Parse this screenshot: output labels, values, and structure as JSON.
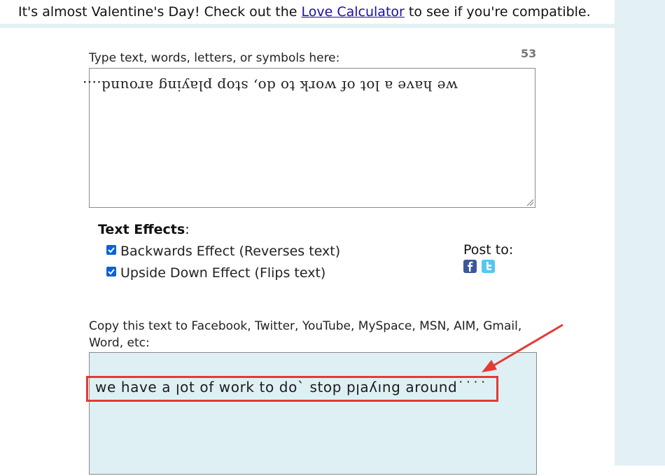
{
  "banner": {
    "prefix": "It's almost Valentine's Day! Check out the",
    "link": "Love Calculator",
    "suffix": "to see if you're compatible."
  },
  "input": {
    "label": "Type text, words, letters, or symbols here:",
    "counter": "53",
    "value": "we have a lot of work to do, stop playing around...."
  },
  "effects": {
    "title": "Text Effects",
    "title_suffix": ":",
    "backwards_label": "Backwards Effect (Reverses text)",
    "backwards_checked": true,
    "upside_label": "Upside Down Effect (Flips text)",
    "upside_checked": true
  },
  "post": {
    "label": "Post to:",
    "icons": [
      "facebook-icon",
      "twitter-icon"
    ]
  },
  "output": {
    "label": "Copy this text to Facebook, Twitter, YouTube, MySpace, MSN, AIM, Gmail, Word, etc:",
    "value": "we have a ןot of work to doˋ stop pןaʎıng around˙˙˙˙"
  },
  "colors": {
    "accent_red": "#e53a35",
    "link": "#1a0dab",
    "output_bg": "#dff0f4",
    "checkbox": "#0b63d1"
  }
}
